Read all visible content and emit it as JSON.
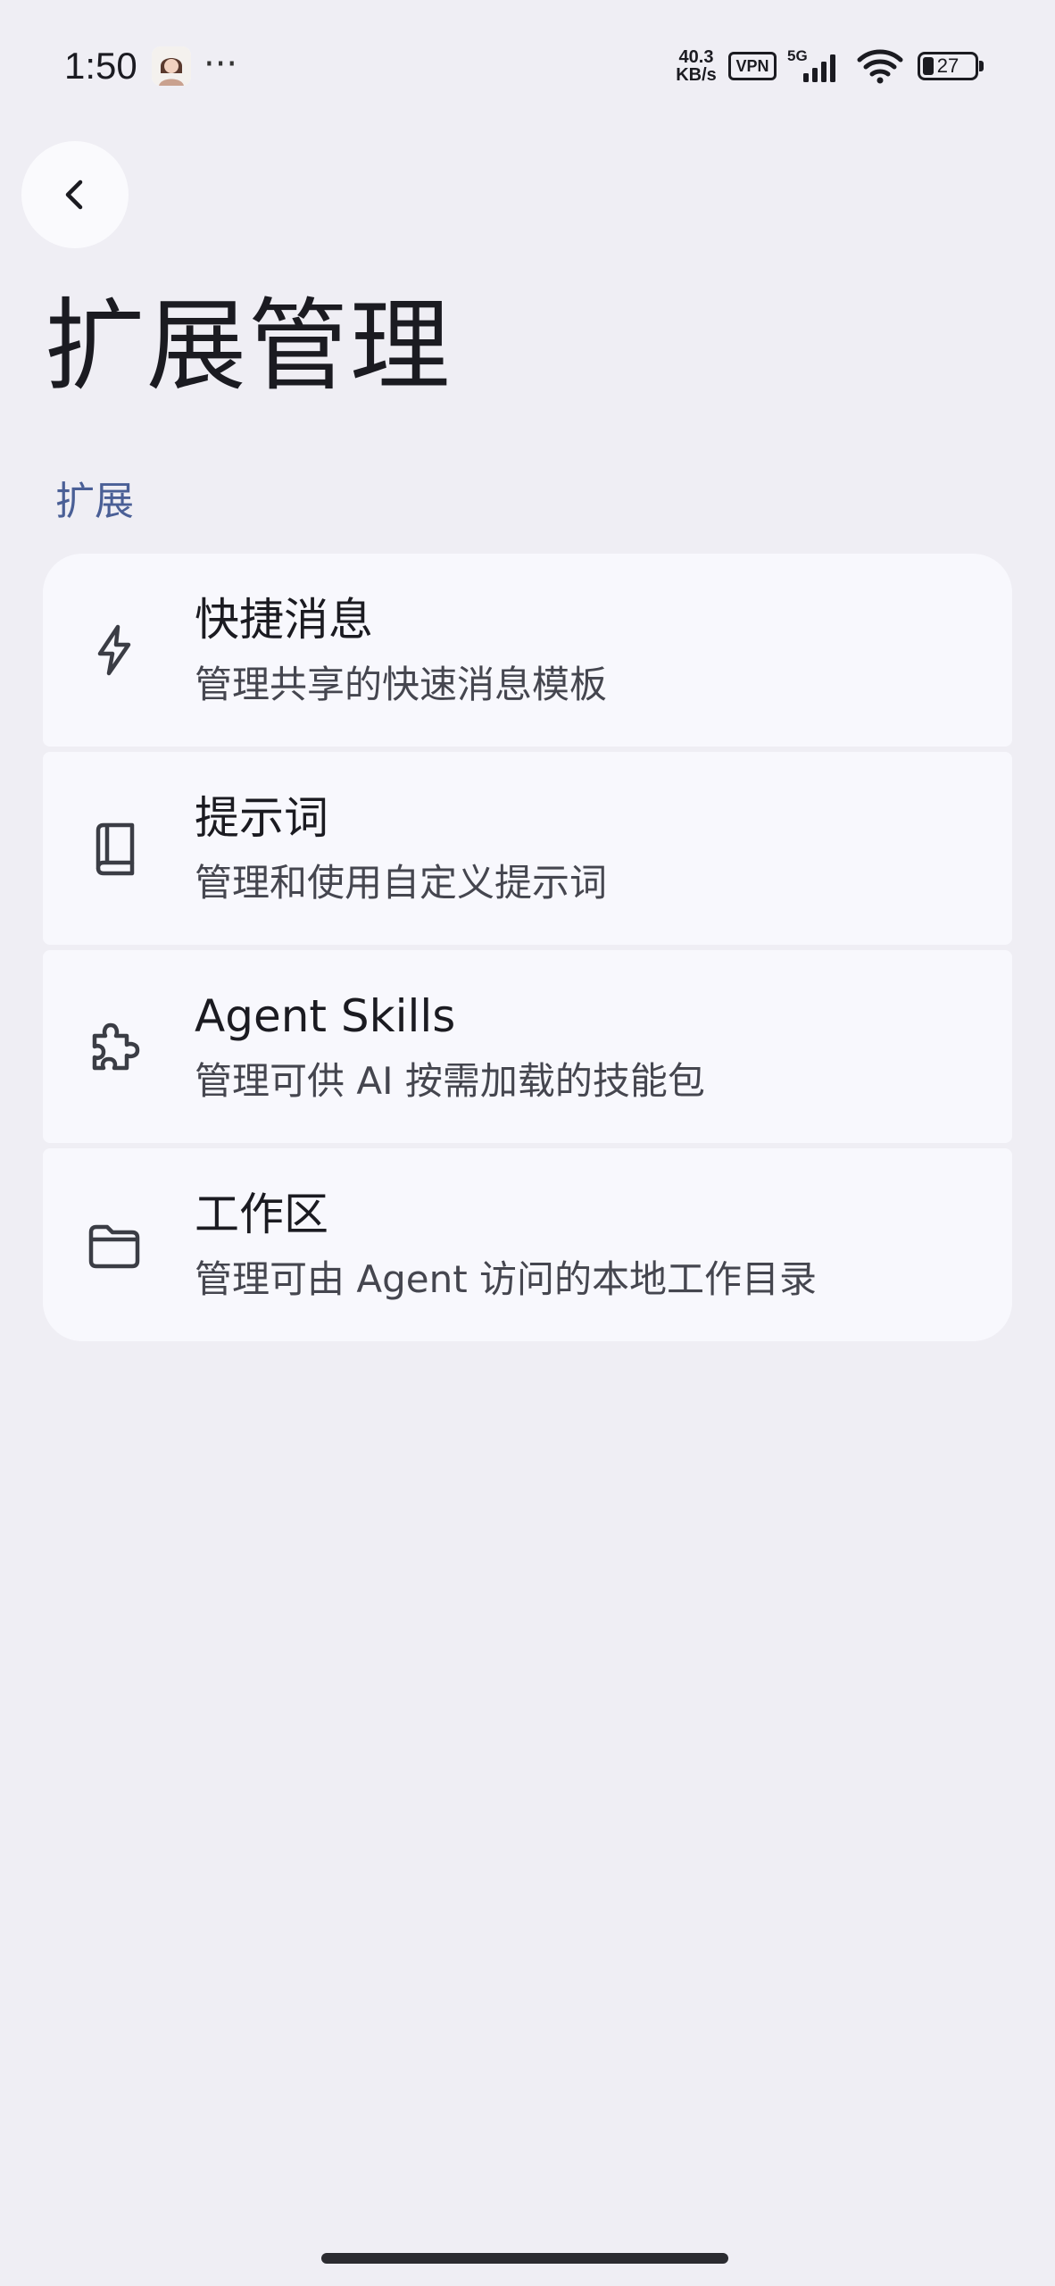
{
  "status_bar": {
    "time": "1:50",
    "more": "···",
    "net_speed_value": "40.3",
    "net_speed_unit": "KB/s",
    "vpn": "VPN",
    "network_type": "5G",
    "battery_level": "27"
  },
  "header": {
    "back_icon": "chevron-left-icon",
    "title": "扩展管理"
  },
  "section": {
    "label": "扩展"
  },
  "items": [
    {
      "icon": "lightning-icon",
      "title": "快捷消息",
      "subtitle": "管理共享的快速消息模板"
    },
    {
      "icon": "book-icon",
      "title": "提示词",
      "subtitle": "管理和使用自定义提示词"
    },
    {
      "icon": "puzzle-icon",
      "title": "Agent Skills",
      "subtitle": "管理可供 AI 按需加载的技能包"
    },
    {
      "icon": "folder-icon",
      "title": "工作区",
      "subtitle": "管理可由 Agent 访问的本地工作目录"
    }
  ],
  "colors": {
    "background": "#efeef4",
    "card": "#f8f8fd",
    "section_label": "#4a5f96",
    "text_primary": "#1b1b21",
    "text_secondary": "#45464f"
  }
}
